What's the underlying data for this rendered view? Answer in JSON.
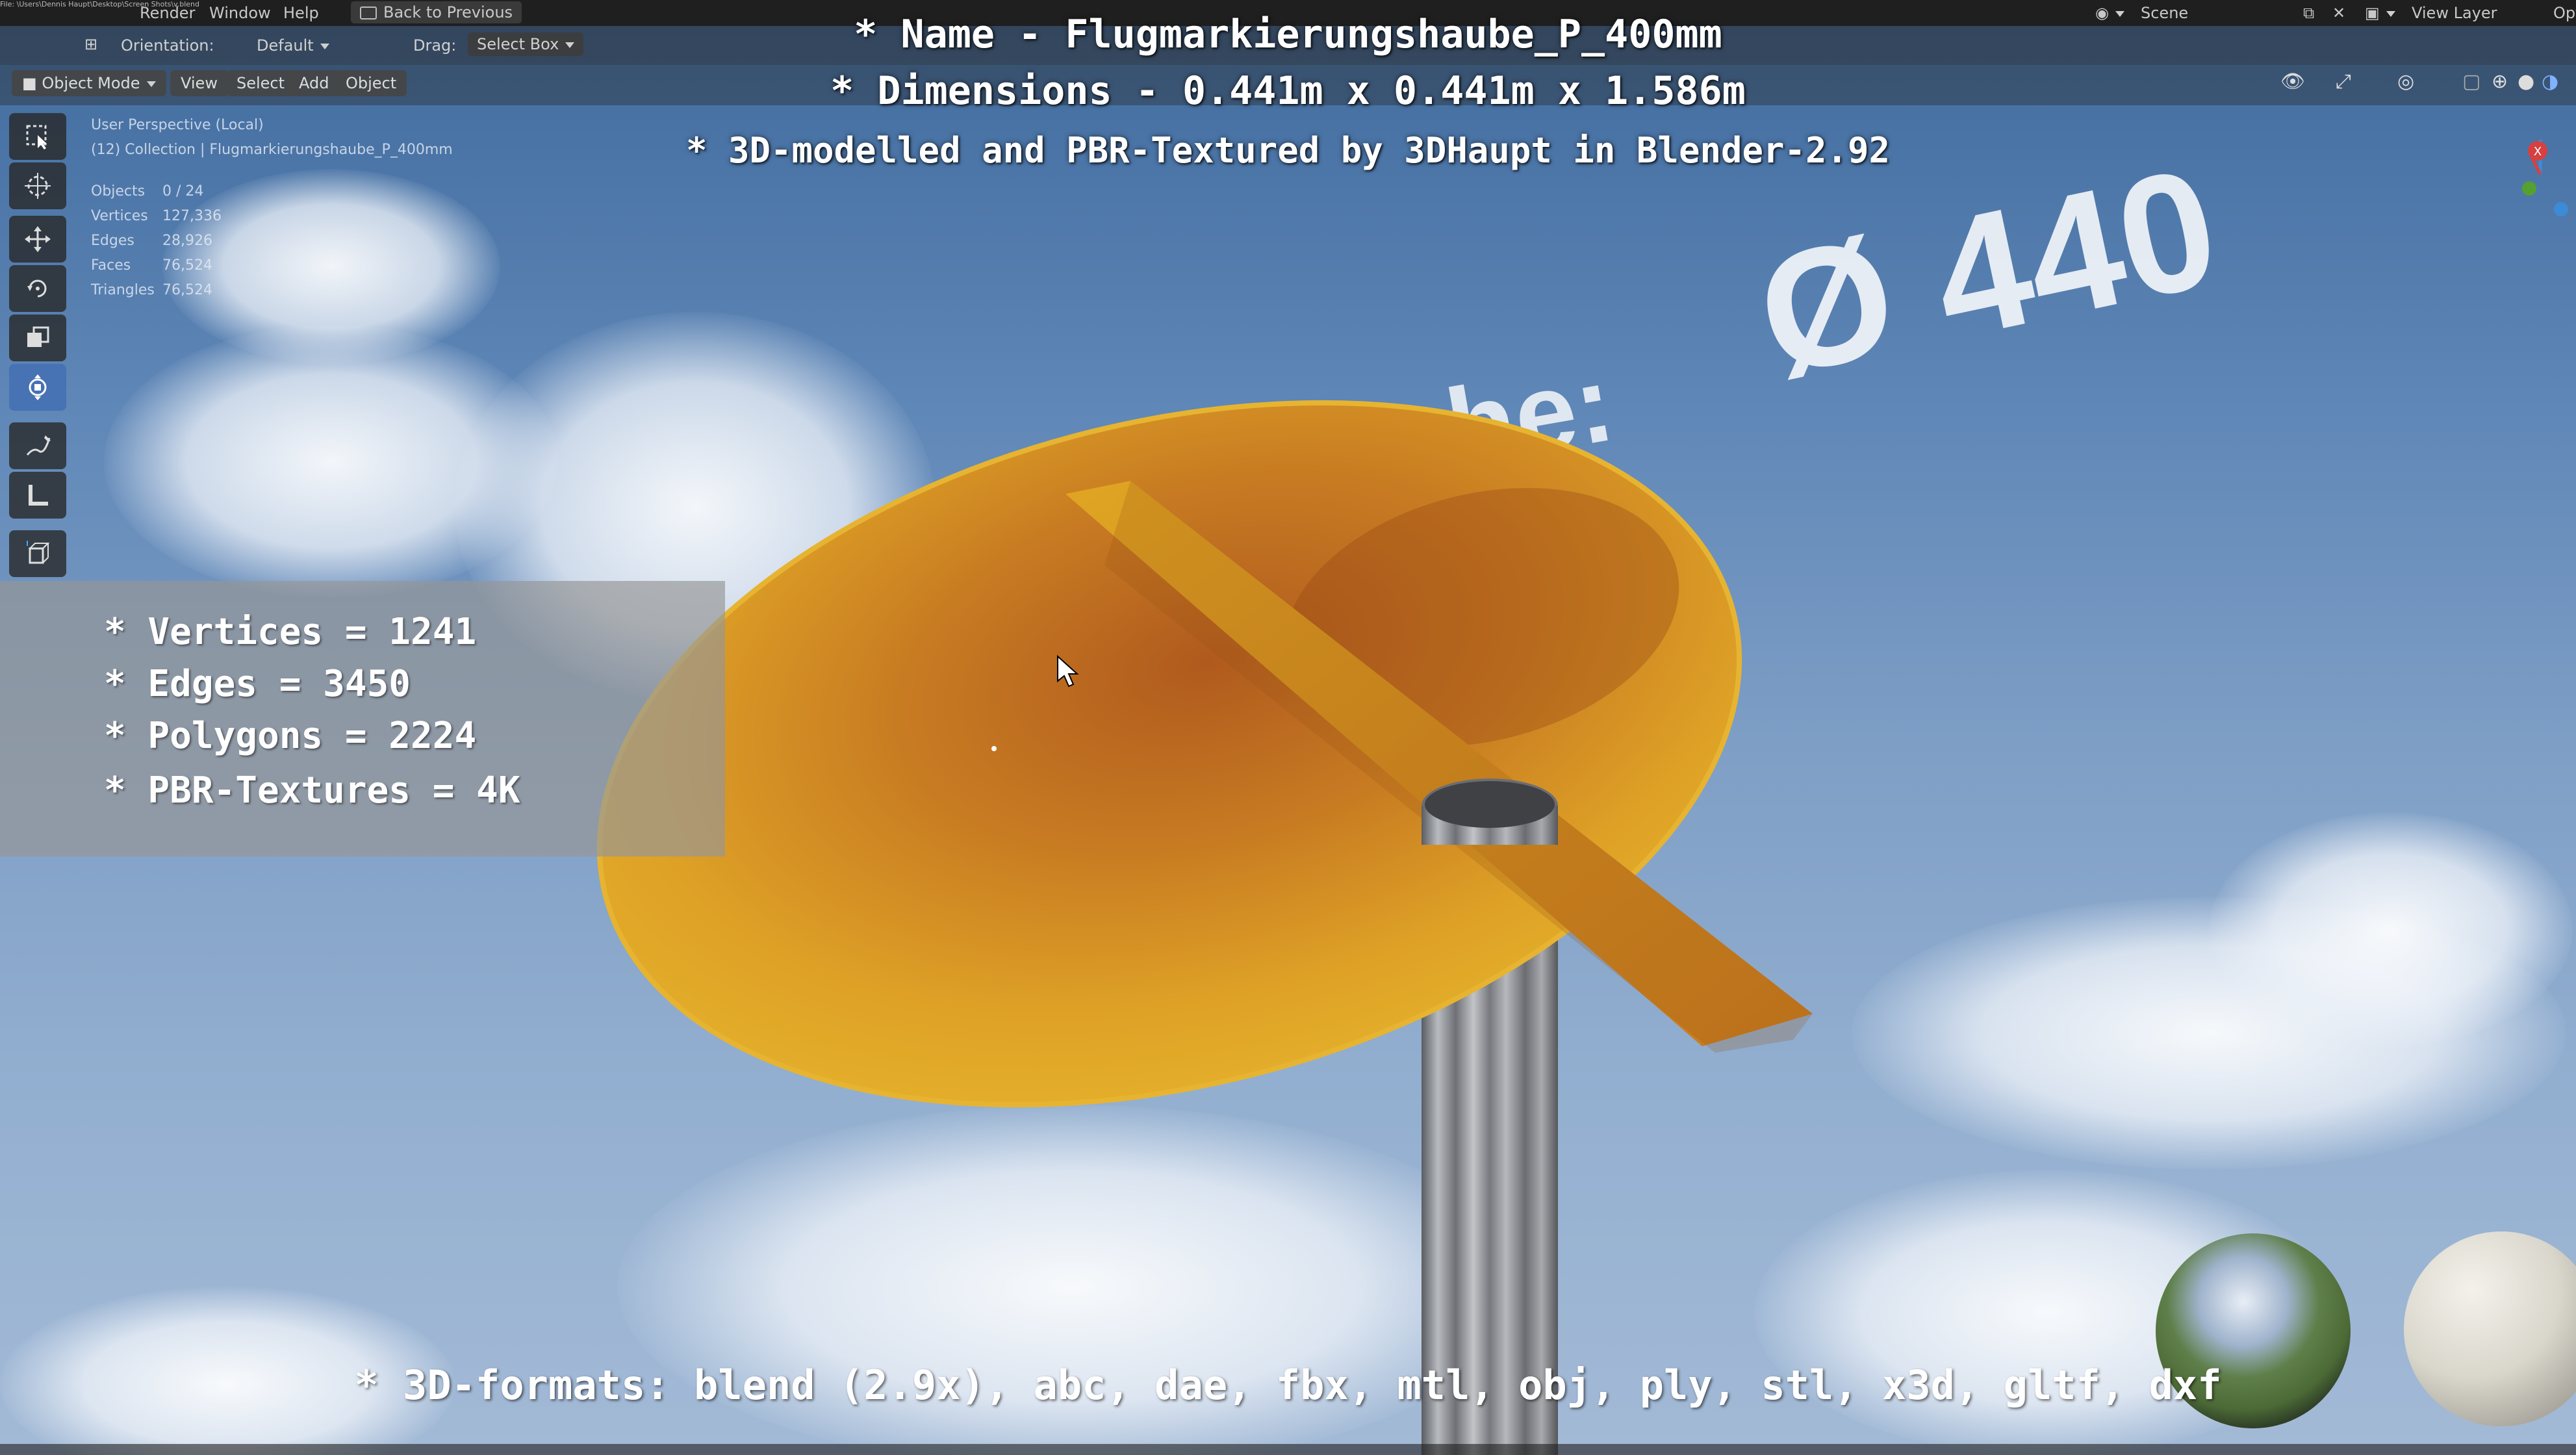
{
  "topbar": {
    "file_path": "File: \\Users\\Dennis Haupt\\Desktop\\Screen Shots\\v.blend",
    "menu_render": "Render",
    "menu_window": "Window",
    "menu_help": "Help",
    "back_button": "Back to Previous",
    "scene_label": "Scene",
    "view_layer_label": "View Layer",
    "options_label": "Opti"
  },
  "header": {
    "orientation_label": "Orientation:",
    "orientation_value": "Default",
    "drag_label": "Drag:",
    "drag_value": "Select Box"
  },
  "viewport_header": {
    "mode": "Object Mode",
    "view": "View",
    "select": "Select",
    "add": "Add",
    "object": "Object"
  },
  "overlay": {
    "name": "* Name - Flugmarkierungshaube_P_400mm",
    "dimensions": "* Dimensions -  0.441m x 0.441m x 1.586m",
    "author": "* 3D-modelled and PBR-Textured by 3DHaupt in Blender-2.92",
    "formats": "* 3D-formats: blend (2.9x), abc, dae, fbx, mtl, obj, ply, stl, x3d, gltf, dxf",
    "embossed_text": "Ø 440",
    "embossed_text2": "he:"
  },
  "viewport_info": {
    "perspective": "User Perspective (Local)",
    "collection": "(12) Collection | Flugmarkierungshaube_P_400mm",
    "objects_label": "Objects",
    "objects_value": "0 / 24",
    "vertices_label": "Vertices",
    "vertices_value": "127,336",
    "edges_label": "Edges",
    "edges_value": "28,926",
    "faces_label": "Faces",
    "faces_value": "76,524",
    "triangles_label": "Triangles",
    "triangles_value": "76,524"
  },
  "stats": {
    "vertices": "* Vertices = 1241",
    "edges": "* Edges = 3450",
    "polygons": "* Polygons = 2224",
    "textures": "* PBR-Textures = 4K"
  },
  "gizmo": {
    "x": "X",
    "y": "Y",
    "z": "Z"
  },
  "toolbar_icons": [
    "select-box-icon",
    "cursor-icon",
    "move-icon",
    "rotate-icon",
    "scale-icon",
    "transform-icon",
    "annotate-icon",
    "measure-icon",
    "add-cube-icon"
  ],
  "colors": {
    "sky_top": "#3f6a9d",
    "sky_bottom": "#a3bad6",
    "cap_yellow": "#e0a821",
    "cap_orange": "#b8621c",
    "pole_gray": "#9a9da3",
    "active_tool": "#4772b3"
  }
}
